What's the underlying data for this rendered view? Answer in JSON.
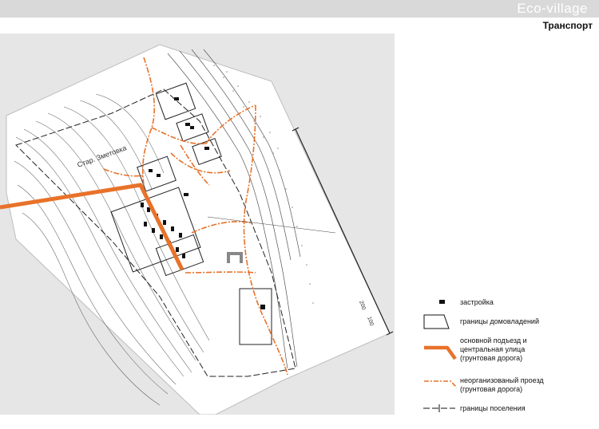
{
  "header": {
    "brand": "Eco-village",
    "section": "Транспорт"
  },
  "map": {
    "labels": {
      "settlement": "Стар. Зметовка",
      "scale_200": "200",
      "scale_100": "100"
    },
    "colors": {
      "main_road": "#e8722a",
      "dirt_road": "#e8722a",
      "background": "#e6e6e6",
      "survey": "#ffffff",
      "linework": "#3a3a3a"
    }
  },
  "legend": {
    "items": [
      {
        "symbol": "building-icon",
        "label": "застройка"
      },
      {
        "symbol": "plot-boundary-icon",
        "label": "границы  домовладений"
      },
      {
        "symbol": "main-road-icon",
        "label": "основной подъезд и\nцентральная улица\n(грунтовая дорога)"
      },
      {
        "symbol": "dirt-road-icon",
        "label": "неорганизованый проезд\n(грунтовая дорога)"
      },
      {
        "symbol": "settlement-boundary-icon",
        "label": "границы поселения"
      }
    ]
  }
}
